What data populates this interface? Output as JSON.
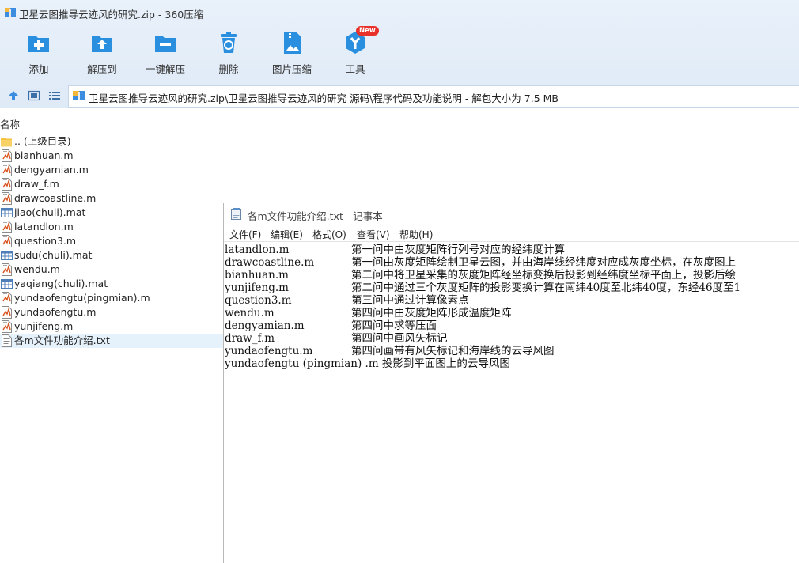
{
  "window": {
    "title": "卫星云图推导云迹风的研究.zip - 360压缩"
  },
  "toolbar": {
    "items": [
      {
        "label": "添加",
        "icon": "add-icon"
      },
      {
        "label": "解压到",
        "icon": "extract-to-icon"
      },
      {
        "label": "一键解压",
        "icon": "one-click-extract-icon"
      },
      {
        "label": "删除",
        "icon": "delete-icon"
      },
      {
        "label": "图片压缩",
        "icon": "image-compress-icon"
      },
      {
        "label": "工具",
        "icon": "tools-icon",
        "badge": "New"
      }
    ]
  },
  "address": {
    "path": "卫星云图推导云迹风的研究.zip\\卫星云图推导云迹风的研究 源码\\程序代码及功能说明 - 解包大小为 7.5 MB"
  },
  "file_list": {
    "column_name": "名称",
    "items": [
      {
        "name": ".. (上级目录)",
        "type": "folder"
      },
      {
        "name": "bianhuan.m",
        "type": "m"
      },
      {
        "name": "dengyamian.m",
        "type": "m"
      },
      {
        "name": "draw_f.m",
        "type": "m"
      },
      {
        "name": "drawcoastline.m",
        "type": "m"
      },
      {
        "name": "jiao(chuli).mat",
        "type": "mat"
      },
      {
        "name": "latandlon.m",
        "type": "m"
      },
      {
        "name": "question3.m",
        "type": "m"
      },
      {
        "name": "sudu(chuli).mat",
        "type": "mat"
      },
      {
        "name": "wendu.m",
        "type": "m"
      },
      {
        "name": "yaqiang(chuli).mat",
        "type": "mat"
      },
      {
        "name": "yundaofengtu(pingmian).m",
        "type": "m"
      },
      {
        "name": "yundaofengtu.m",
        "type": "m"
      },
      {
        "name": "yunjifeng.m",
        "type": "m"
      },
      {
        "name": "各m文件功能介绍.txt",
        "type": "txt",
        "selected": true
      }
    ]
  },
  "notepad": {
    "title": "各m文件功能介绍.txt - 记事本",
    "menu": [
      "文件(F)",
      "编辑(E)",
      "格式(O)",
      "查看(V)",
      "帮助(H)"
    ],
    "lines": [
      {
        "file": "latandlon.m",
        "desc": "第一问中由灰度矩阵行列号对应的经纬度计算"
      },
      {
        "file": "drawcoastline.m",
        "desc": "第一问由灰度矩阵绘制卫星云图，并由海岸线经纬度对应成灰度坐标，在灰度图上"
      },
      {
        "file": "bianhuan.m",
        "desc": "第二问中将卫星采集的灰度矩阵经坐标变换后投影到经纬度坐标平面上，投影后绘"
      },
      {
        "file": "yunjifeng.m",
        "desc": "第二问中通过三个灰度矩阵的投影变换计算在南纬40度至北纬40度，东经46度至1"
      },
      {
        "file": "question3.m",
        "desc": "第三问中通过计算像素点"
      },
      {
        "file": "wendu.m",
        "desc": "第四问中由灰度矩阵形成温度矩阵"
      },
      {
        "file": "dengyamian.m",
        "desc": "第四问中求等压面"
      },
      {
        "file": "draw_f.m",
        "desc": "第四问中画风矢标记"
      },
      {
        "file": "yundaofengtu.m",
        "desc": "第四问画带有风矢标记和海岸线的云导风图"
      }
    ],
    "last_line": "yundaofengtu (pingmian) .m 投影到平面图上的云导风图"
  },
  "colors": {
    "accent_blue": "#2b8fe0",
    "selection": "#e5f1fb",
    "badge_red": "#e8312a"
  }
}
